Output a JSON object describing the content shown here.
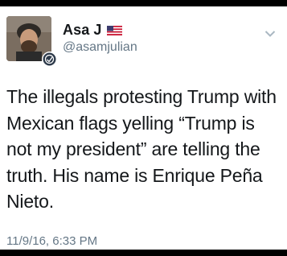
{
  "tweet": {
    "display_name": "Asa J",
    "handle": "@asamjulian",
    "text": "The illegals protesting Trump with Mexican flags yelling “Trump is not my president” are telling the truth. His name is Enrique Peña Nieto.",
    "timestamp": "11/9/16, 6:33 PM"
  },
  "icons": {
    "flag": "us-flag-icon",
    "menu": "chevron-down-icon",
    "badge": "badge-icon"
  },
  "colors": {
    "text_primary": "#14171a",
    "text_secondary": "#657786",
    "background": "#ffffff"
  }
}
